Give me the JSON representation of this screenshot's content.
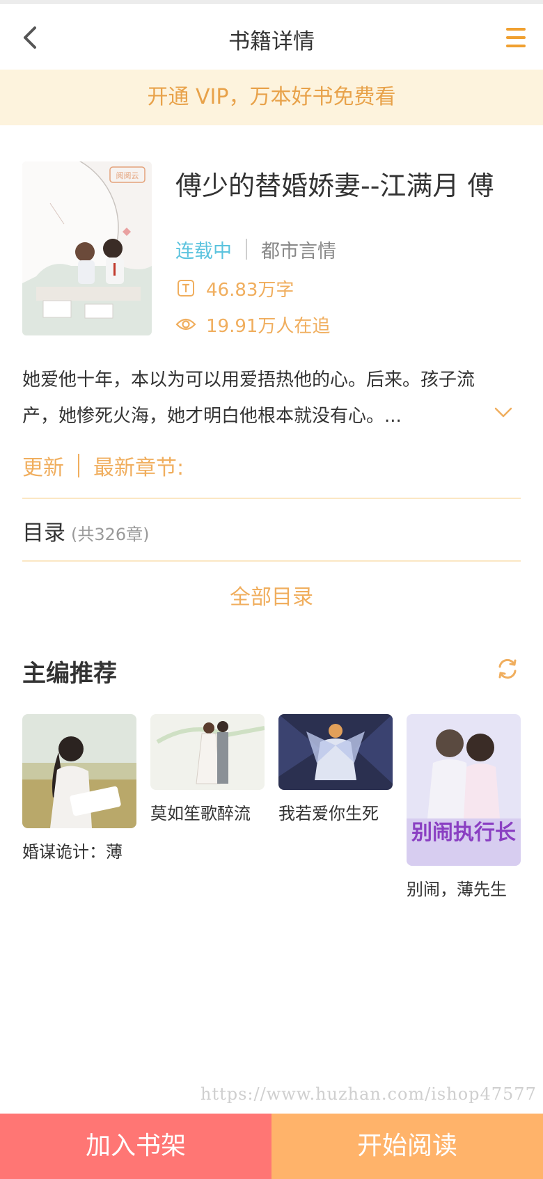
{
  "header": {
    "title": "书籍详情"
  },
  "vip_banner": {
    "text": "开通 VIP，万本好书免费看"
  },
  "book": {
    "title": "傅少的替婚娇妻--江满月 傅",
    "status": "连载中",
    "category": "都市言情",
    "word_count": "46.83万字",
    "followers": "19.91万人在追",
    "description": "她爱他十年，本以为可以用爱捂热他的心。后来。孩子流产，她惨死火海，她才明白他根本就没有心。...",
    "cover_badge": "阅阅云"
  },
  "update": {
    "label": "更新",
    "latest_label": "最新章节:"
  },
  "catalog": {
    "label": "目录",
    "count": "(共326章)",
    "all_label": "全部目录"
  },
  "recommend": {
    "title": "主编推荐",
    "items": [
      {
        "title": "婚谋诡计：薄"
      },
      {
        "title": "莫如笙歌醉流"
      },
      {
        "title": "我若爱你生死"
      },
      {
        "title": "别闹，薄先生",
        "cover_text": "别闹执行长"
      }
    ]
  },
  "watermark": "https://www.huzhan.com/ishop47577",
  "bottom": {
    "add_shelf": "加入书架",
    "start_read": "开始阅读"
  },
  "colors": {
    "accent": "#f0ae5e",
    "status": "#5bc3de",
    "shelf_btn": "#ff7674",
    "read_btn": "#ffb36a",
    "banner_bg": "#fdf3dd"
  }
}
